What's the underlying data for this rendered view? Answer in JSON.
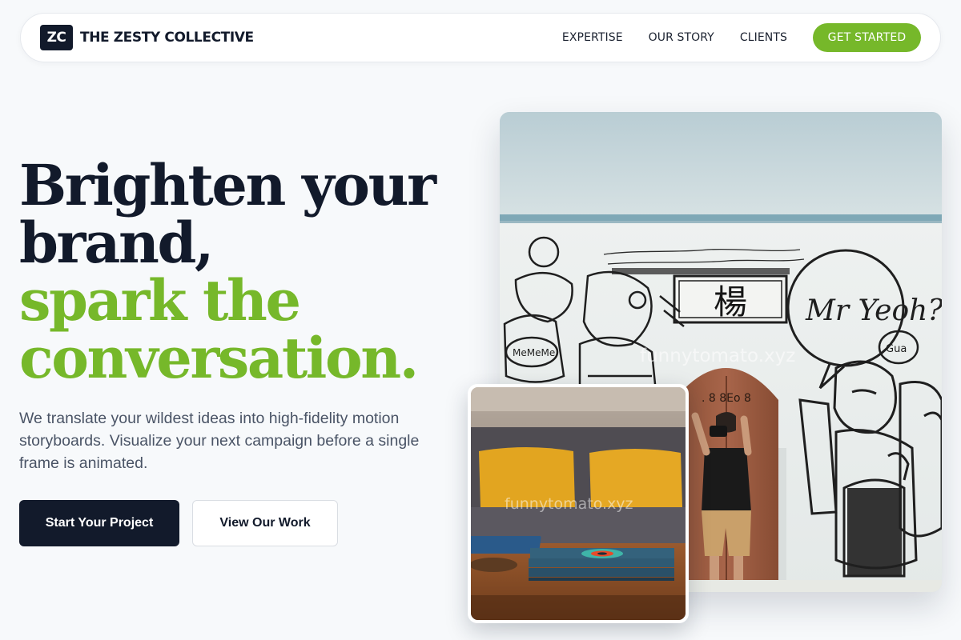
{
  "nav": {
    "logo_mark": "ZC",
    "brand_name": "THE ZESTY COLLECTIVE",
    "links": [
      "EXPERTISE",
      "OUR STORY",
      "CLIENTS"
    ],
    "cta_label": "GET STARTED"
  },
  "hero": {
    "headline_lines": [
      "Brighten your",
      "brand,"
    ],
    "accent_lines": [
      "spark the",
      "conversation."
    ],
    "subcopy": "We translate your wildest ideas into high-fidelity motion storyboards. Visualize your next campaign before a single frame is animated.",
    "primary_button": "Start Your Project",
    "secondary_button": "View Our Work"
  },
  "media": {
    "main_watermark": "funnytomato.xyz",
    "inset_watermark": "funnytomato.xyz",
    "mural_sign_text": "楊",
    "mural_door_text": ". 8   8Eo 8",
    "mural_speech": "Mr Yeoh?",
    "mural_bubble_small": "Gua",
    "mural_bubble_left": "MeMeMe"
  },
  "colors": {
    "accent": "#76b82a",
    "ink": "#121a2b",
    "page_bg": "#f7f9fb"
  }
}
